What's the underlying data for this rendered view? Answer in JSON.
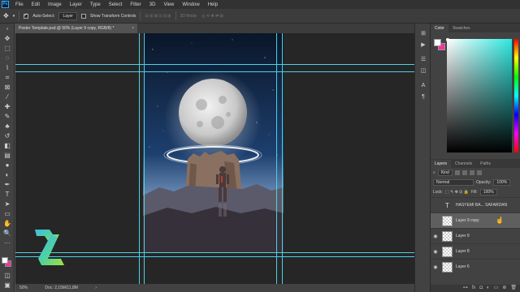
{
  "menu": {
    "logo": "Ps",
    "items": [
      "File",
      "Edit",
      "Image",
      "Layer",
      "Type",
      "Select",
      "Filter",
      "3D",
      "View",
      "Window",
      "Help"
    ]
  },
  "options": {
    "auto_select_label": "Auto-Select:",
    "auto_select_checked": true,
    "auto_select_value": "Layer",
    "transform_label": "Show Transform Controls",
    "transform_checked": false,
    "mode_label": "3D Mode:"
  },
  "document": {
    "tab_title": "Poster Template.psd @ 50% (Layer 9 copy, RGB/8) *",
    "close": "×"
  },
  "status": {
    "zoom": "50%",
    "doc": "Doc: 2,15M/11,8M"
  },
  "panels": {
    "color_tabs": [
      "Color",
      "Swatches"
    ],
    "layers_tabs": [
      "Layers",
      "Channels",
      "Paths"
    ],
    "kind_label": "Kind",
    "blend_mode": "Normal",
    "opacity_label": "Opacity:",
    "opacity_value": "100%",
    "lock_label": "Lock:",
    "fill_label": "Fill:",
    "fill_value": "100%"
  },
  "layers": [
    {
      "name": "HASYEMI BA... SAFARDAN",
      "type": "text",
      "visible": false,
      "selected": false
    },
    {
      "name": "Layer 9 copy",
      "type": "pixel",
      "visible": false,
      "selected": true
    },
    {
      "name": "Layer 9",
      "type": "pixel",
      "visible": true,
      "selected": false
    },
    {
      "name": "Layer 8",
      "type": "pixel",
      "visible": true,
      "selected": false
    },
    {
      "name": "Layer 6",
      "type": "pixel",
      "visible": true,
      "selected": false
    }
  ],
  "colors": {
    "foreground": "#ffffff",
    "background": "#ff2fa0",
    "guide": "#4bd2e6",
    "selected_hue": "#2ee8e0"
  },
  "icons": {
    "move": "move-icon",
    "eye": "eye-icon"
  }
}
